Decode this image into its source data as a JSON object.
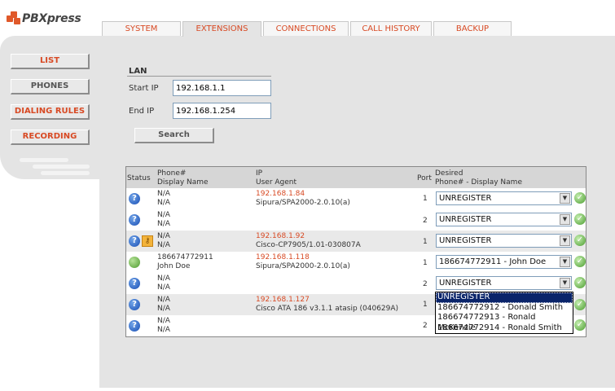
{
  "app": {
    "logo_text": "PBXpress"
  },
  "tabs": [
    {
      "label": "SYSTEM"
    },
    {
      "label": "EXTENSIONS"
    },
    {
      "label": "CONNECTIONS"
    },
    {
      "label": "CALL HISTORY"
    },
    {
      "label": "BACKUP"
    }
  ],
  "sidebar": {
    "items": [
      {
        "label": "LIST"
      },
      {
        "label": "PHONES"
      },
      {
        "label": "DIALING RULES"
      },
      {
        "label": "RECORDING"
      }
    ]
  },
  "lan": {
    "title": "LAN",
    "start_label": "Start IP",
    "start_value": "192.168.1.1",
    "end_label": "End IP",
    "end_value": "192.168.1.254",
    "search_label": "Search"
  },
  "table": {
    "headers": {
      "status": "Status",
      "phone": "Phone#",
      "display": "Display Name",
      "ip": "IP",
      "agent": "User Agent",
      "port": "Port",
      "desired1": "Desired",
      "desired2": "Phone# - Display Name"
    },
    "rows": [
      {
        "phone": "N/A",
        "name": "N/A",
        "ip": "192.168.1.84",
        "agent": "Sipura/SPA2000-2.0.10(a)",
        "port": "1",
        "desired": "UNREGISTER"
      },
      {
        "phone": "N/A",
        "name": "N/A",
        "ip": "",
        "agent": "",
        "port": "2",
        "desired": "UNREGISTER"
      },
      {
        "phone": "N/A",
        "name": "N/A",
        "ip": "192.168.1.92",
        "agent": "Cisco-CP7905/1.01-030807A",
        "port": "1",
        "desired": "UNREGISTER"
      },
      {
        "phone": "186674772911",
        "name": "John Doe",
        "ip": "192.168.1.118",
        "agent": "Sipura/SPA2000-2.0.10(a)",
        "port": "1",
        "desired": "186674772911 - John Doe"
      },
      {
        "phone": "N/A",
        "name": "N/A",
        "ip": "",
        "agent": "",
        "port": "2",
        "desired": "UNREGISTER"
      },
      {
        "phone": "N/A",
        "name": "N/A",
        "ip": "192.168.1.127",
        "agent": "Cisco ATA 186 v3.1.1 atasip (040629A)",
        "port": "1",
        "desired": ""
      },
      {
        "phone": "N/A",
        "name": "N/A",
        "ip": "",
        "agent": "",
        "port": "2",
        "desired": ""
      }
    ],
    "dropdown_options": [
      "UNREGISTER",
      "186674772912 - Donald Smith",
      "186674772913 - Ronald McKenzie",
      "186674772914 - Ronald Smith"
    ]
  },
  "colors": {
    "accent": "#d84a24",
    "panel": "#e4e4e4",
    "highlight": "#0a246a"
  },
  "icons": [
    "help-icon",
    "key-icon",
    "online-icon",
    "confirm-check-icon",
    "dropdown-arrow-icon"
  ]
}
